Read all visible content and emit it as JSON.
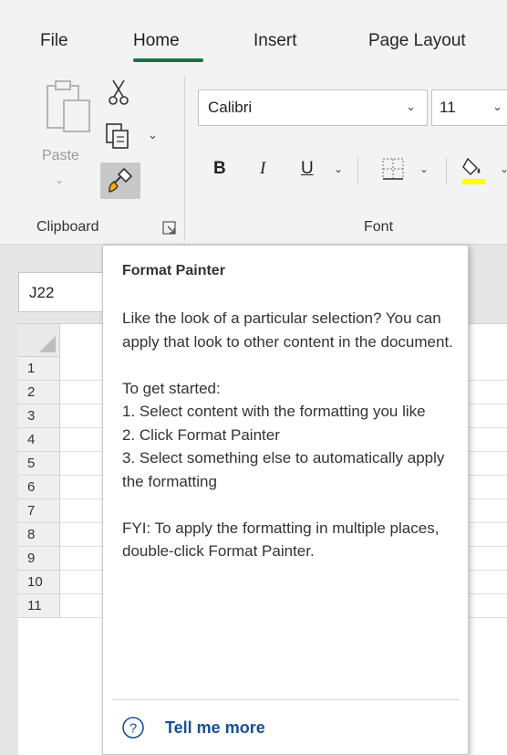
{
  "tabs": [
    {
      "label": "File"
    },
    {
      "label": "Home"
    },
    {
      "label": "Insert"
    },
    {
      "label": "Page Layout"
    }
  ],
  "clipboard": {
    "paste_label": "Paste",
    "group_label": "Clipboard",
    "icons": [
      "paste-icon",
      "cut-icon",
      "copy-icon",
      "format-painter-icon",
      "dialog-launcher-icon"
    ]
  },
  "font": {
    "name": "Calibri",
    "size": "11",
    "bold_label": "B",
    "italic_label": "I",
    "underline_label": "U",
    "group_label": "Font",
    "fill_color": "#ffff00"
  },
  "namebox": {
    "value": "J22"
  },
  "rows": [
    "1",
    "2",
    "3",
    "4",
    "5",
    "6",
    "7",
    "8",
    "9",
    "10",
    "11"
  ],
  "tooltip": {
    "title": "Format Painter",
    "paragraphs": [
      "Like the look of a particular selection? You can apply that look to other content in the document.",
      "To get started:",
      "1. Select content with the formatting you like",
      "2. Click Format Painter",
      "3. Select something else to automatically apply the formatting",
      "FYI: To apply the formatting in multiple places, double-click Format Painter."
    ],
    "link": "Tell me more"
  },
  "colors": {
    "accent": "#1e7145",
    "link": "#1a4f96"
  }
}
